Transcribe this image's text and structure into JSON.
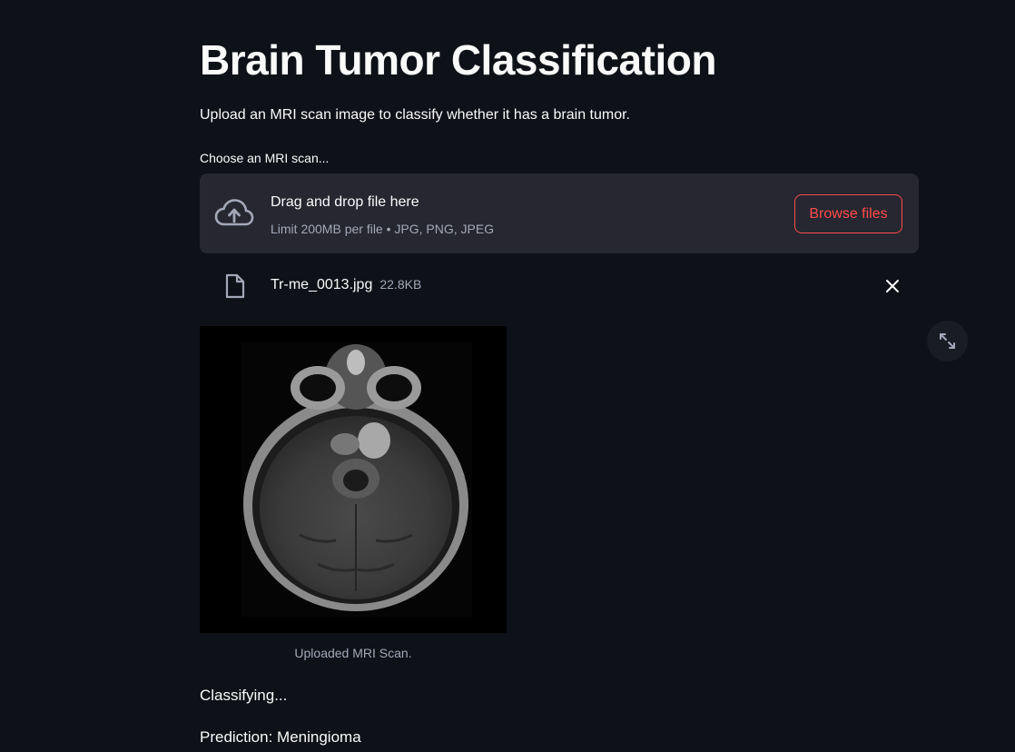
{
  "page": {
    "title": "Brain Tumor Classification",
    "description": "Upload an MRI scan image to classify whether it has a brain tumor."
  },
  "uploader": {
    "label": "Choose an MRI scan...",
    "drop_text": "Drag and drop file here",
    "limit_text": "Limit 200MB per file • JPG, PNG, JPEG",
    "browse_label": "Browse files",
    "icon": "cloud-upload-icon"
  },
  "uploaded_file": {
    "name": "Tr-me_0013.jpg",
    "size": "22.8KB",
    "icon": "file-icon",
    "remove_icon": "close-icon"
  },
  "image": {
    "caption": "Uploaded MRI Scan.",
    "fullscreen_icon": "expand-icon"
  },
  "result": {
    "status": "Classifying...",
    "prediction": "Prediction: Meningioma"
  },
  "colors": {
    "background": "#0e1117",
    "surface": "#262730",
    "accent": "#ff4b4b",
    "text": "#fafafa",
    "muted_text": "#a3a8b8"
  }
}
